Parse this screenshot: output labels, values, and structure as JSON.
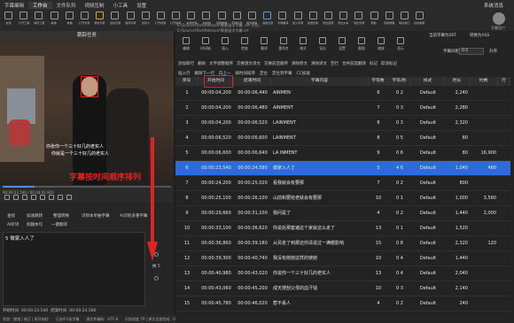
{
  "titlebar": {
    "menus": [
      "字幕编辑",
      "工作台",
      "文件队列",
      "视频压制",
      "小工具",
      "设置"
    ],
    "active": "工作台",
    "sys": "系统消息"
  },
  "toolbar": {
    "items": [
      {
        "label": "新建",
        "icon": "new-icon",
        "color": "#9a9a9a"
      },
      {
        "label": "打开工程",
        "icon": "open-project-icon",
        "color": "#9a9a9a"
      },
      {
        "label": "保存工程",
        "icon": "save-project-icon",
        "color": "#9a9a9a"
      },
      {
        "label": "撤销",
        "icon": "undo-icon",
        "color": "#9a9a9a"
      },
      {
        "label": "重做",
        "icon": "redo-icon",
        "color": "#9a9a9a"
      },
      {
        "label": "打开字幕",
        "icon": "open-subtitle-icon",
        "color": "#9a9a9a"
      },
      {
        "label": "添加字幕",
        "icon": "add-subtitle-icon",
        "color": "#e0a23a"
      },
      {
        "label": "追加字幕",
        "icon": "append-subtitle-icon",
        "color": "#9a9a9a"
      },
      {
        "label": "保存字幕",
        "icon": "save-subtitle-icon",
        "color": "#9a9a9a"
      },
      {
        "label": "另存为",
        "icon": "save-as-icon",
        "color": "#9a9a9a"
      },
      {
        "label": "打开视频",
        "icon": "open-video-icon",
        "color": "#9a9a9a"
      },
      {
        "label": "打开音频",
        "icon": "open-audio-icon",
        "color": "#9a9a9a"
      },
      {
        "label": "关闭视频",
        "icon": "close-video-icon",
        "color": "#9a9a9a"
      },
      {
        "label": "时间轴",
        "icon": "timeline-icon",
        "color": "#9a9a9a"
      },
      {
        "label": "视频截图",
        "icon": "screenshot-icon",
        "color": "#9a9a9a"
      },
      {
        "label": "字幕检查",
        "icon": "check-icon",
        "color": "#9a9a9a"
      },
      {
        "label": "格式转换",
        "icon": "convert-icon",
        "color": "#9a9a9a"
      },
      {
        "label": "语音识别",
        "icon": "speech-icon",
        "color": "#5a9ad8"
      },
      {
        "label": "字幕翻译",
        "icon": "translate-icon",
        "color": "#9a9a9a"
      },
      {
        "label": "嵌入字幕",
        "icon": "embed-icon",
        "color": "#9a9a9a"
      },
      {
        "label": "批量压制",
        "icon": "batch-icon",
        "color": "#9a9a9a"
      },
      {
        "label": "导出音频",
        "icon": "export-audio-icon",
        "color": "#9a9a9a"
      },
      {
        "label": "导出文本",
        "icon": "export-text-icon",
        "color": "#9a9a9a"
      },
      {
        "label": "导出字幕",
        "icon": "export-subtitle-icon",
        "color": "#9a9a9a"
      },
      {
        "label": "帮助",
        "icon": "help-icon",
        "color": "#9a9a9a"
      },
      {
        "label": "使用教程",
        "icon": "tutorial-icon",
        "color": "#9a9a9a"
      },
      {
        "label": "联系我们",
        "icon": "contact-icon",
        "color": "#9a9a9a"
      },
      {
        "label": "在线客服",
        "icon": "service-icon",
        "color": "#9a9a9a"
      }
    ],
    "user": "字幕用户"
  },
  "left": {
    "task_title": "跟踪任务",
    "subtitle_line1": "你张你一个三十好几的老实人",
    "subtitle_line2": "你就是一个三十好几的老实人",
    "annotation": "字幕按时间顺序排列",
    "timecode": "00:00:23.540 / 00:04:01.920",
    "tools_row1": [
      "查找",
      "加速跳转",
      "整理转换",
      "识别本单曲字幕",
      "AI识别多重字幕"
    ],
    "tools_row2": [
      "AI听译",
      "机翻本句",
      "一键翻译"
    ],
    "edit_text": "5 做家入人了",
    "start_label": "开始时间",
    "start_value": "00:00:23.540",
    "end_label": "结束时间",
    "end_value": "00:00:24.580",
    "zoom_label": "换 5"
  },
  "status": {
    "items": [
      "状态：就绪 | 修正 | 帧开始秒",
      "已选中1条字幕",
      "源文件编码：UTF-8",
      "识别进度 79 | 译文全部完成：0"
    ]
  },
  "right": {
    "path1": "E:\\Source\\Test\\Release\\零基础学字幕 .srt 识别...",
    "path2": "E:\\Source\\Test\\Release\\零基础学字幕.srt",
    "btn_cn": "当前字幕为SRT",
    "btn_ass": "转换为ASS",
    "label_gap": "字幕间距",
    "gap_value": "0.5",
    "sort_label": "升序",
    "panel_actions": [
      "编辑",
      "时间轴",
      "插入",
      "检查",
      "翻译",
      "重命名",
      "格式",
      "导出",
      "设置",
      "截图",
      "缩放",
      "显示"
    ],
    "toolbar1": [
      "添加新行",
      "删除",
      "文字调整顺序",
      "交换源文译文",
      "交换前后顺序",
      "清除原文",
      "清除译文",
      "空行",
      "合并前后翻译",
      "标记",
      "取消标记"
    ],
    "toolbar2": [
      "插入行",
      "删除下一行",
      "向上一",
      "按时间排序",
      "定位",
      "定位到字幕",
      "CC加速"
    ],
    "columns": [
      "序号",
      "开始时间",
      "结束时间",
      "字幕内容",
      "字符数",
      "字符/秒",
      "样式",
      "时长",
      "约剩",
      "行"
    ],
    "rows": [
      {
        "no": "1",
        "start": "00:00:04,200",
        "end": "00:00:06,440",
        "text": "AINMEN",
        "chars": "6",
        "cps": "0 2",
        "style": "Default",
        "dur": "2,240",
        "remain": "",
        "flag": ""
      },
      {
        "no": "2",
        "start": "00:00:04,200",
        "end": "00:00:06,480",
        "text": "AINMENT",
        "chars": "7",
        "cps": "0 3",
        "style": "Default",
        "dur": "2,280",
        "remain": "",
        "flag": ""
      },
      {
        "no": "3",
        "start": "00:00:04,200",
        "end": "00:00:06,520",
        "text": "LAINMENT",
        "chars": "8",
        "cps": "0 3",
        "style": "Default",
        "dur": "2,320",
        "remain": "",
        "flag": ""
      },
      {
        "no": "4",
        "start": "00:00:06,520",
        "end": "00:00:06,600",
        "text": "LAINMENT",
        "chars": "8",
        "cps": "0 5",
        "style": "Default",
        "dur": "80",
        "remain": "",
        "flag": ""
      },
      {
        "no": "5",
        "start": "00:00:06,600",
        "end": "00:00:06,640",
        "text": "LA INMENT",
        "chars": "9",
        "cps": "0 6",
        "style": "Default",
        "dur": "80",
        "remain": "16,900",
        "flag": ""
      },
      {
        "no": "6",
        "start": "00:00:23,540",
        "end": "00:00:24,580",
        "text": "做家入人了",
        "chars": "5",
        "cps": "4 6",
        "style": "Default",
        "dur": "1,040",
        "remain": "480",
        "flag": ""
      },
      {
        "no": "7",
        "start": "00:00:24,200",
        "end": "00:00:25,020",
        "text": "看我就会有要那",
        "chars": "7",
        "cps": "0 2",
        "style": "Default",
        "dur": "800",
        "remain": "",
        "flag": ""
      },
      {
        "no": "8",
        "start": "00:00:25,100",
        "end": "00:00:26,100",
        "text": "山前和要抢老就会有要那",
        "chars": "10",
        "cps": "0 1",
        "style": "Default",
        "dur": "1,000",
        "remain": "3,560",
        "flag": ""
      },
      {
        "no": "9",
        "start": "00:00:29,660",
        "end": "00:00:31,100",
        "text": "我问是了",
        "chars": "4",
        "cps": "0 2",
        "style": "Default",
        "dur": "1,440",
        "remain": "2,000",
        "flag": ""
      },
      {
        "no": "10",
        "start": "00:00:33,100",
        "end": "00:00:36,620",
        "text": "你说处那套诸这个家就这么走了",
        "chars": "13",
        "cps": "0 1",
        "style": "Default",
        "dur": "1,520",
        "remain": "",
        "flag": ""
      },
      {
        "no": "11",
        "start": "00:00:36,860",
        "end": "00:00:39,180",
        "text": "从另走了到那还你清说过一满眼影响",
        "chars": "15",
        "cps": "0 8",
        "style": "Default",
        "dur": "2,320",
        "remain": "120",
        "flag": ""
      },
      {
        "no": "12",
        "start": "00:00:39,300",
        "end": "00:00:40,740",
        "text": "我没有她她这样的使她",
        "chars": "10",
        "cps": "0 4",
        "style": "Default",
        "dur": "1,440",
        "remain": "",
        "flag": ""
      },
      {
        "no": "13",
        "start": "00:00:40,980",
        "end": "00:00:43,020",
        "text": "你说你一个三十好几的老实人",
        "chars": "13",
        "cps": "0 4",
        "style": "Default",
        "dur": "2,040",
        "remain": "",
        "flag": ""
      },
      {
        "no": "14",
        "start": "00:00:43,060",
        "end": "00:00:45,200",
        "text": "成天搜刮父母的血汗钱",
        "chars": "10",
        "cps": "0 3",
        "style": "Default",
        "dur": "2,140",
        "remain": "",
        "flag": ""
      },
      {
        "no": "15",
        "start": "00:00:45,780",
        "end": "00:00:46,020",
        "text": "惹不丢人",
        "chars": "4",
        "cps": "0 2",
        "style": "Default",
        "dur": "240",
        "remain": "",
        "flag": ""
      }
    ]
  }
}
